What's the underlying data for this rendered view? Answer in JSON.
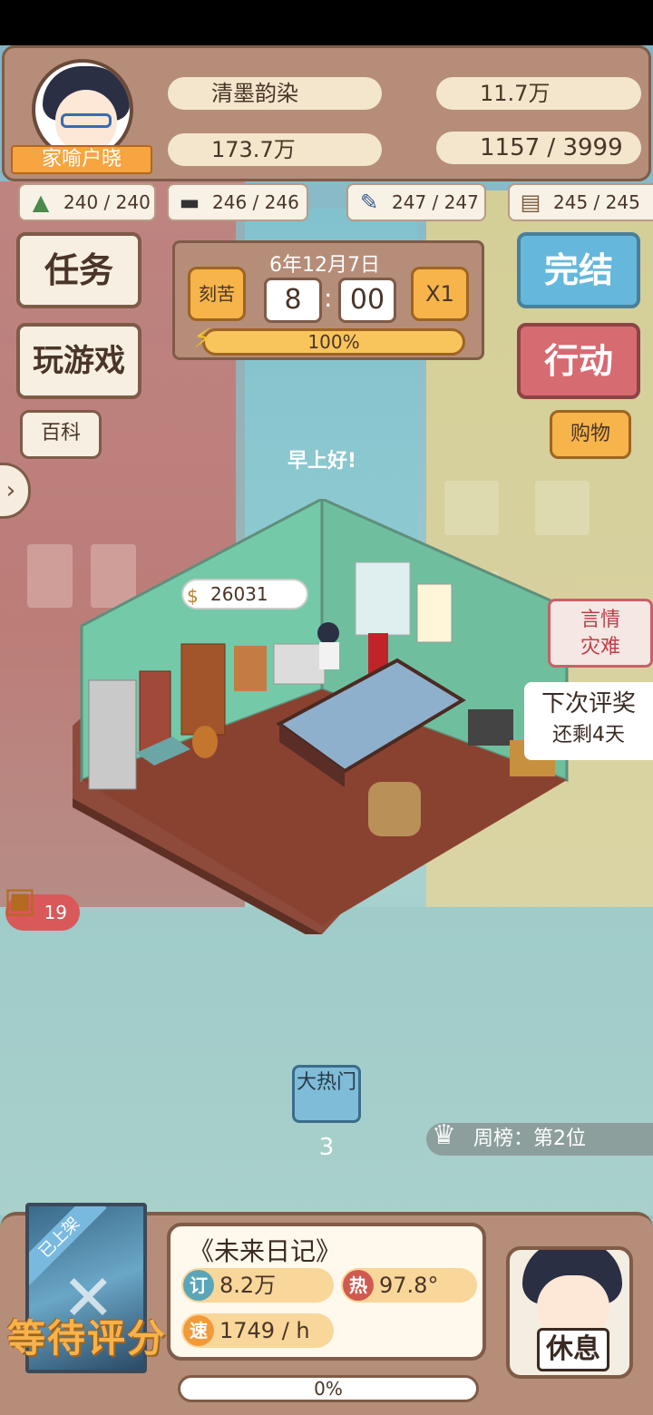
{
  "player": {
    "title_ribbon": "家喻户晓",
    "name": "清墨韵染",
    "fans": "173.7万",
    "money": "11.7万",
    "inspiration": "1157 / 3999"
  },
  "skills": [
    {
      "icon": "mountain-icon",
      "value": "240 / 240"
    },
    {
      "icon": "hat-icon",
      "value": "246 / 246"
    },
    {
      "icon": "brush-icon",
      "value": "247 / 247"
    },
    {
      "icon": "book-icon",
      "value": "245 / 245"
    }
  ],
  "left_buttons": {
    "task": "任务",
    "play_game": "玩游戏",
    "wiki": "百科"
  },
  "right_buttons": {
    "finish": "完结",
    "action": "行动",
    "shop": "购物"
  },
  "clock": {
    "date": "6年12月7日",
    "diligent": "刻苦",
    "hour": "8",
    "minute": "00",
    "speed": "X1",
    "energy_label": "100%",
    "energy_fraction": 1.0
  },
  "room": {
    "greeting": "早上好!",
    "coins": "26031"
  },
  "event": {
    "line1": "言情",
    "line2": "灾难"
  },
  "award": {
    "line1": "下次评奖",
    "line2": "还剩4天"
  },
  "chest": {
    "count": "19"
  },
  "hot": {
    "label": "大热门",
    "count": "3"
  },
  "rank": {
    "text": "周榜：第2位"
  },
  "novel": {
    "shelf_badge": "已上架",
    "status": "等待评分",
    "title": "《未来日记》",
    "subscriptions_badge": "订",
    "subscriptions": "8.2万",
    "heat_badge": "热",
    "heat": "97.8°",
    "speed_badge": "速",
    "speed": "1749 / h",
    "progress_label": "0%"
  },
  "rest": {
    "label": "休息"
  },
  "colors": {
    "panel": "#b58d79",
    "panel_border": "#7f5b48",
    "blue_button": "#66b7dc",
    "red_button": "#d76b72",
    "orange_button": "#f6b44a"
  }
}
